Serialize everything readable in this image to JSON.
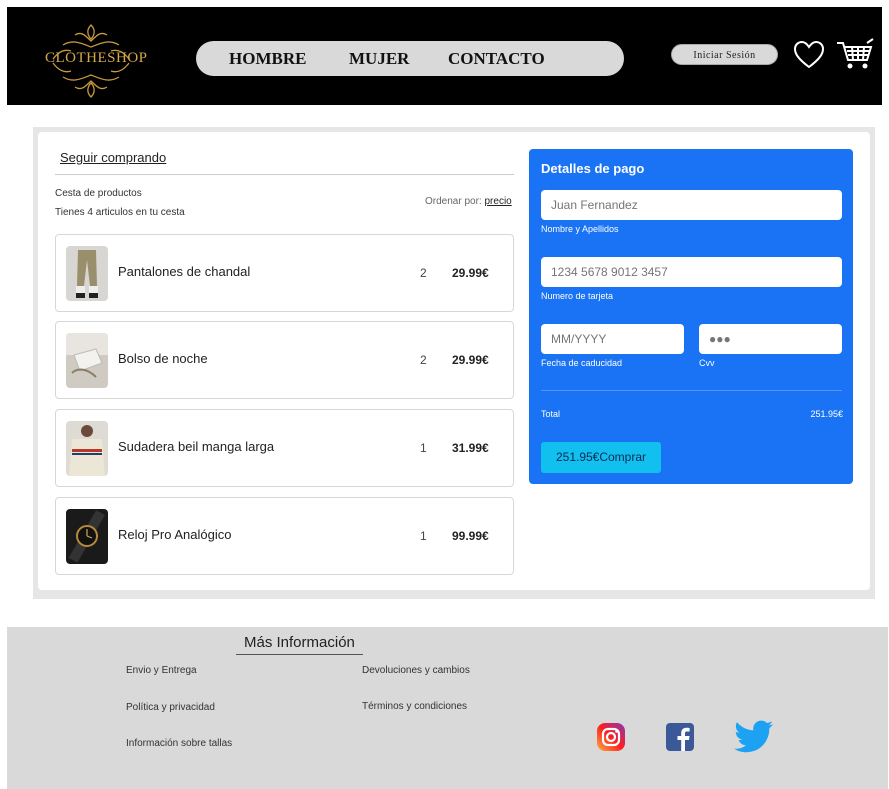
{
  "header": {
    "logo_text": "CLOTHESHOP",
    "nav": [
      "HOMBRE",
      "MUJER",
      "CONTACTO"
    ],
    "login_label": "Iniciar Sesión"
  },
  "cart": {
    "continue_label": "Seguir comprando",
    "title": "Cesta de productos",
    "subtitle": "Tienes 4 articulos en tu cesta",
    "sort_label": "Ordenar por:",
    "sort_value": "precio",
    "items": [
      {
        "name": "Pantalones de chandal",
        "qty": "2",
        "price": "29.99€"
      },
      {
        "name": "Bolso de noche",
        "qty": "2",
        "price": "29.99€"
      },
      {
        "name": "Sudadera beil manga larga",
        "qty": "1",
        "price": "31.99€"
      },
      {
        "name": "Reloj Pro Analógico",
        "qty": "1",
        "price": "99.99€"
      }
    ]
  },
  "payment": {
    "title": "Detalles de pago",
    "name_placeholder": "Juan Fernandez",
    "name_label": "Nombre y Apellidos",
    "card_placeholder": "1234 5678 9012 3457",
    "card_label": "Numero de tarjeta",
    "expiry_placeholder": "MM/YYYY",
    "expiry_label": "Fecha de caducidad",
    "cvv_placeholder": "●●●",
    "cvv_label": "Cvv",
    "total_label": "Total",
    "total_value": "251.95€",
    "buy_label": "251.95€Comprar"
  },
  "footer": {
    "title": "Más Información",
    "links": [
      "Envio y Entrega",
      "Devoluciones y cambios",
      "Política y privacidad",
      "Términos y condiciones",
      "Información sobre tallas"
    ]
  },
  "colors": {
    "payment_bg": "#1a73f5",
    "buy_button": "#12c0f0",
    "facebook": "#3b5998",
    "twitter": "#1da1f2"
  },
  "icons": [
    "heart-icon",
    "cart-icon",
    "instagram-icon",
    "facebook-icon",
    "twitter-icon"
  ]
}
